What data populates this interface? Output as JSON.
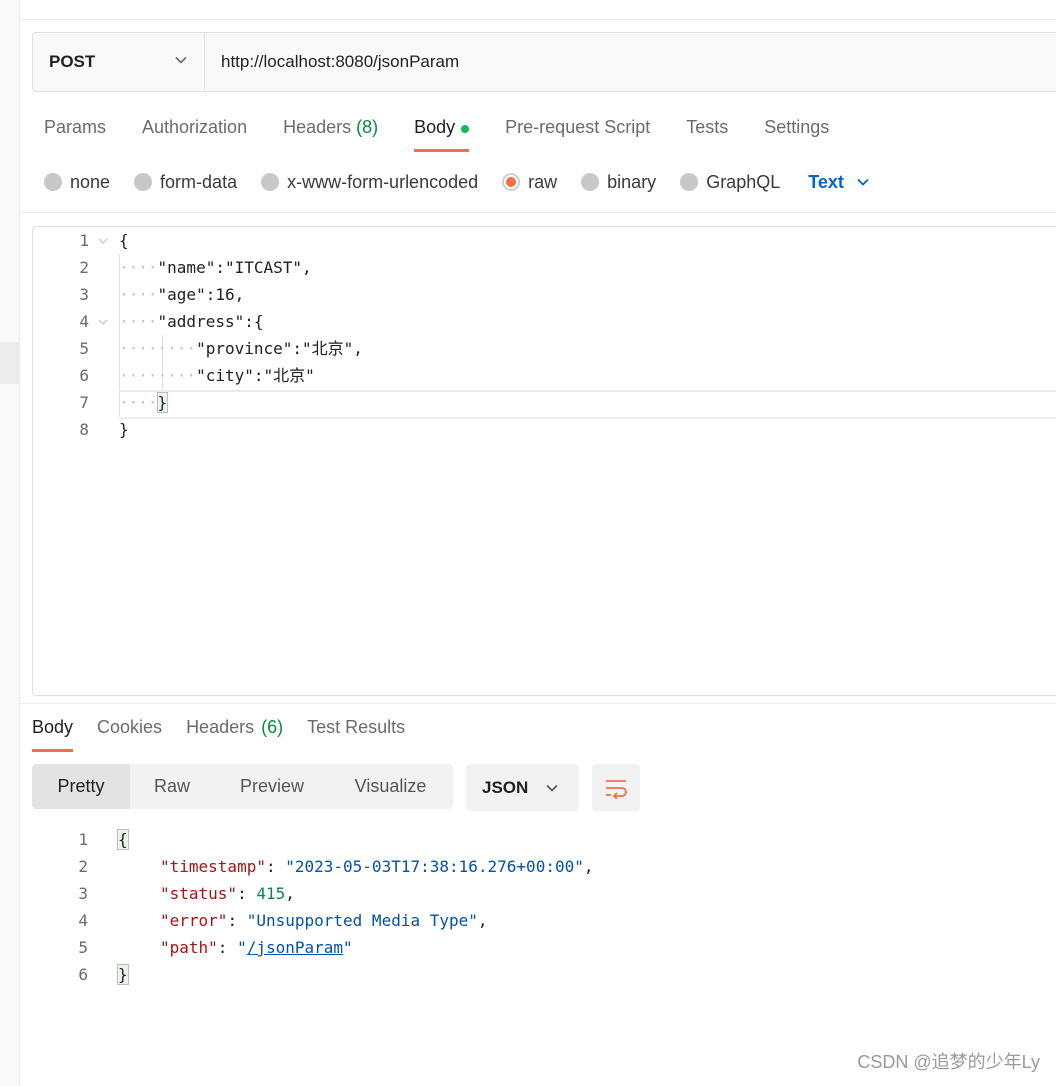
{
  "request": {
    "method": "POST",
    "url": "http://localhost:8080/jsonParam"
  },
  "req_tabs": {
    "params": "Params",
    "authorization": "Authorization",
    "headers": "Headers",
    "headers_count": "(8)",
    "body": "Body",
    "prerequest": "Pre-request Script",
    "tests": "Tests",
    "settings": "Settings"
  },
  "body_types": {
    "none": "none",
    "form_data": "form-data",
    "urlencoded": "x-www-form-urlencoded",
    "raw": "raw",
    "binary": "binary",
    "graphql": "GraphQL",
    "selected_format": "Text"
  },
  "request_body": {
    "lines": [
      {
        "num": "1",
        "indent": "",
        "text": "{"
      },
      {
        "num": "2",
        "indent": "····",
        "text": "\"name\":\"ITCAST\","
      },
      {
        "num": "3",
        "indent": "····",
        "text": "\"age\":16,"
      },
      {
        "num": "4",
        "indent": "····",
        "text": "\"address\":{"
      },
      {
        "num": "5",
        "indent": "········",
        "text": "\"province\":\"北京\","
      },
      {
        "num": "6",
        "indent": "········",
        "text": "\"city\":\"北京\""
      },
      {
        "num": "7",
        "indent": "····",
        "text": "}"
      },
      {
        "num": "8",
        "indent": "",
        "text": "}"
      }
    ]
  },
  "resp_tabs": {
    "body": "Body",
    "cookies": "Cookies",
    "headers": "Headers",
    "headers_count": "(6)",
    "test_results": "Test Results"
  },
  "view": {
    "pretty": "Pretty",
    "raw": "Raw",
    "preview": "Preview",
    "visualize": "Visualize",
    "format": "JSON"
  },
  "response_body": {
    "line_numbers": [
      "1",
      "2",
      "3",
      "4",
      "5",
      "6"
    ],
    "open": "{",
    "close": "}",
    "timestamp_key": "\"timestamp\"",
    "timestamp_val": "\"2023-05-03T17:38:16.276+00:00\"",
    "status_key": "\"status\"",
    "status_val": "415",
    "error_key": "\"error\"",
    "error_val": "\"Unsupported Media Type\"",
    "path_key": "\"path\"",
    "path_val": "/jsonParam"
  },
  "watermark": "CSDN @追梦的少年Ly",
  "colors": {
    "accent": "#ef7144",
    "link": "#0265d2",
    "green": "#0a8a3c"
  }
}
